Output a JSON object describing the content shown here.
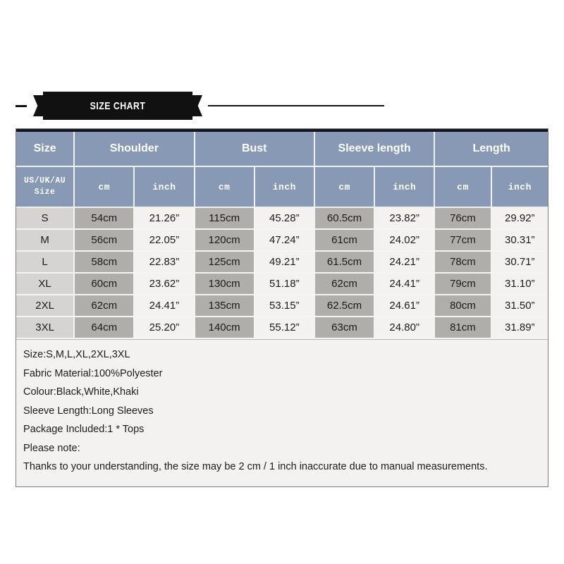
{
  "banner": {
    "title": "SIZE CHART"
  },
  "table": {
    "group_headers": [
      {
        "label": "Size",
        "span": 1
      },
      {
        "label": "Shoulder",
        "span": 2
      },
      {
        "label": "Bust",
        "span": 2
      },
      {
        "label": "Sleeve length",
        "span": 2
      },
      {
        "label": "Length",
        "span": 2
      }
    ],
    "sub_headers": [
      "US/UK/AU\nSize",
      "cm",
      "inch",
      "cm",
      "inch",
      "cm",
      "inch",
      "cm",
      "inch"
    ],
    "size_label_line1": "US/UK/AU",
    "size_label_line2": "Size",
    "rows": [
      {
        "size": "S",
        "shoulder_cm": "54cm",
        "shoulder_inch": "21.26”",
        "bust_cm": "115cm",
        "bust_inch": "45.28”",
        "sleeve_cm": "60.5cm",
        "sleeve_inch": "23.82”",
        "length_cm": "76cm",
        "length_inch": "29.92”"
      },
      {
        "size": "M",
        "shoulder_cm": "56cm",
        "shoulder_inch": "22.05”",
        "bust_cm": "120cm",
        "bust_inch": "47.24”",
        "sleeve_cm": "61cm",
        "sleeve_inch": "24.02”",
        "length_cm": "77cm",
        "length_inch": "30.31”"
      },
      {
        "size": "L",
        "shoulder_cm": "58cm",
        "shoulder_inch": "22.83”",
        "bust_cm": "125cm",
        "bust_inch": "49.21”",
        "sleeve_cm": "61.5cm",
        "sleeve_inch": "24.21”",
        "length_cm": "78cm",
        "length_inch": "30.71”"
      },
      {
        "size": "XL",
        "shoulder_cm": "60cm",
        "shoulder_inch": "23.62”",
        "bust_cm": "130cm",
        "bust_inch": "51.18”",
        "sleeve_cm": "62cm",
        "sleeve_inch": "24.41”",
        "length_cm": "79cm",
        "length_inch": "31.10”"
      },
      {
        "size": "2XL",
        "shoulder_cm": "62cm",
        "shoulder_inch": "24.41”",
        "bust_cm": "135cm",
        "bust_inch": "53.15”",
        "sleeve_cm": "62.5cm",
        "sleeve_inch": "24.61”",
        "length_cm": "80cm",
        "length_inch": "31.50”"
      },
      {
        "size": "3XL",
        "shoulder_cm": "64cm",
        "shoulder_inch": "25.20”",
        "bust_cm": "140cm",
        "bust_inch": "55.12”",
        "sleeve_cm": "63cm",
        "sleeve_inch": "24.80”",
        "length_cm": "81cm",
        "length_inch": "31.89”"
      }
    ]
  },
  "notes": [
    "Size:S,M,L,XL,2XL,3XL",
    "Fabric Material:100%Polyester",
    "Colour:Black,White,Khaki",
    "Sleeve Length:Long Sleeves",
    "Package Included:1 * Tops",
    "Please note:",
    "Thanks to your understanding, the size may be 2 cm / 1 inch inaccurate due to manual measurements."
  ],
  "colors": {
    "header_blue": "#8799b5",
    "cell_shaded": "#b0aeab",
    "cell_light": "#f3f2f0",
    "size_col": "#d5d4d2",
    "banner_black": "#111111",
    "text_dark": "#1b1b1b"
  }
}
